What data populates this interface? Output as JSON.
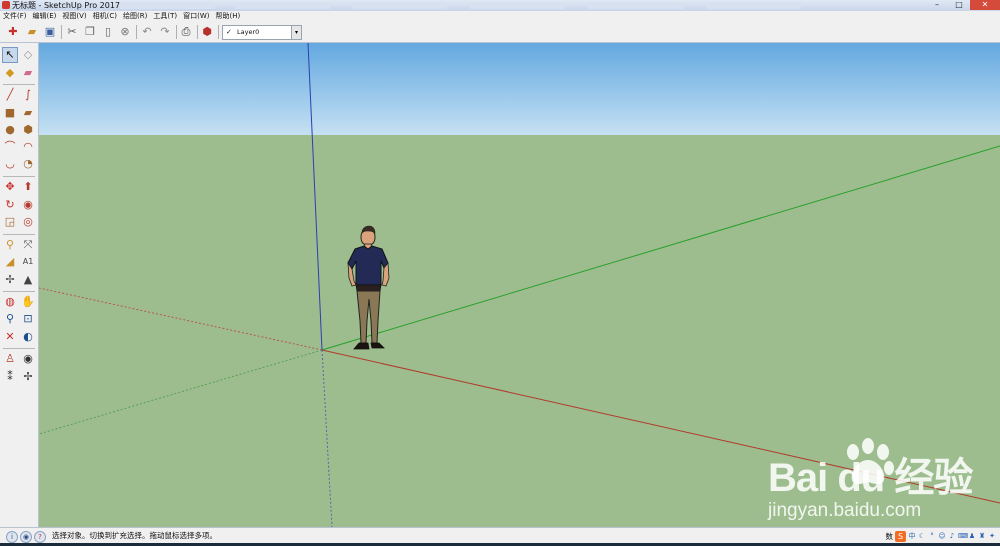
{
  "window": {
    "title": "无标题 - SketchUp Pro 2017",
    "minimize_glyph": "–",
    "maximize_glyph": "□",
    "close_glyph": "✕"
  },
  "menu": [
    "文件(F)",
    "编辑(E)",
    "视图(V)",
    "相机(C)",
    "绘图(R)",
    "工具(T)",
    "窗口(W)",
    "帮助(H)"
  ],
  "toolbar": {
    "layer_value": "Layer0",
    "layer_check": "✓",
    "dropdown_glyph": "▾"
  },
  "status": {
    "text": "选择对象。切换到扩充选择。拖动鼠标选择多项。"
  },
  "tray": {
    "label": "数",
    "ime_glyph": "S"
  },
  "watermark": {
    "logo_text": "Bai  du 经验",
    "url": "jingyan.baidu.com"
  },
  "colors": {
    "red_axis": "#c0392b",
    "green_axis": "#27a02a",
    "blue_axis": "#2b3fb0",
    "ground": "#9dbd8f",
    "sky": "#63a8e0"
  }
}
